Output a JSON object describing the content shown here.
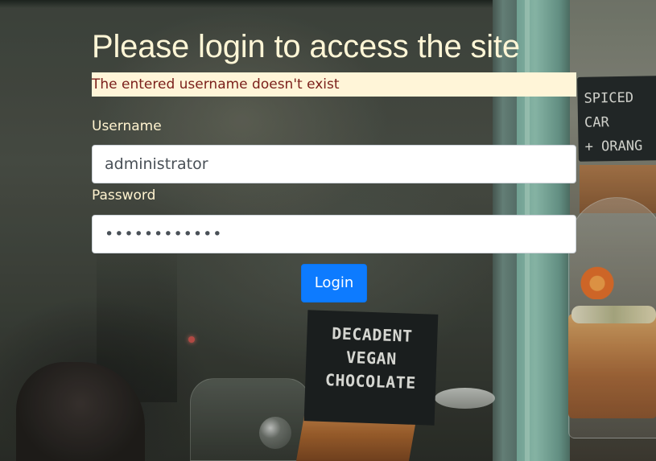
{
  "page": {
    "title": "Please login to access the site",
    "error_message": "The entered username doesn't exist"
  },
  "form": {
    "username_label": "Username",
    "username_value": "administrator",
    "password_label": "Password",
    "password_value": "••••••••••••",
    "login_label": "Login"
  },
  "background_signs": {
    "left_sign_lines": [
      "DECADENT",
      "VEGAN",
      "CHOCOLATE"
    ],
    "right_sign_lines": [
      "SPICED CAR",
      "+ ORANG"
    ]
  },
  "colors": {
    "title_text": "#fff6d6",
    "alert_background": "#fff5d8",
    "alert_text": "#7a1f1a",
    "login_button": "#0d7bff"
  }
}
